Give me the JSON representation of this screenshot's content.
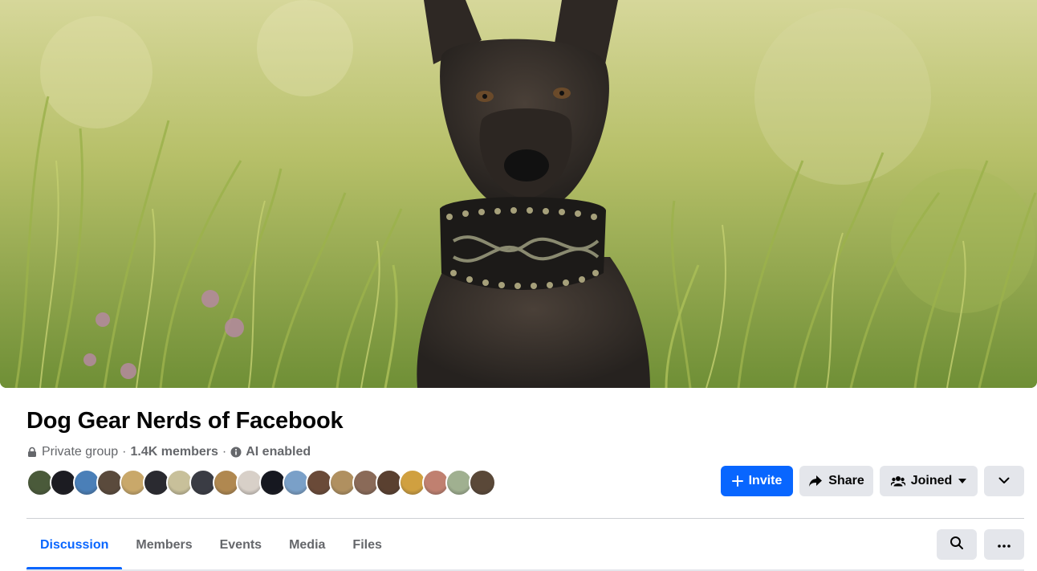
{
  "group": {
    "name": "Dog Gear Nerds of Facebook",
    "privacy": "Private group",
    "separator": "·",
    "members": "1.4K members",
    "ai": "AI enabled"
  },
  "actions": {
    "invite": "Invite",
    "share": "Share",
    "joined": "Joined"
  },
  "tabs": [
    {
      "label": "Discussion",
      "active": true
    },
    {
      "label": "Members",
      "active": false
    },
    {
      "label": "Events",
      "active": false
    },
    {
      "label": "Media",
      "active": false
    },
    {
      "label": "Files",
      "active": false
    }
  ],
  "member_avatar_colors": [
    "#4a5a3a",
    "#1c1c22",
    "#4a7fb8",
    "#5a4a3c",
    "#c9a86a",
    "#2a2a30",
    "#c8c09a",
    "#3a3c44",
    "#b08850",
    "#d8d0c8",
    "#161820",
    "#7aa0c8",
    "#6a4a38",
    "#b09060",
    "#8a6a58",
    "#5a4030",
    "#d0a040",
    "#c08070",
    "#a0b090",
    "#5a4838"
  ],
  "colors": {
    "primary": "#0866ff",
    "secondary_button": "#e4e6eb",
    "muted_text": "#65676b"
  },
  "icons": {
    "privacy": "lock-icon",
    "ai": "info-icon",
    "invite": "plus-icon",
    "share": "share-arrow-icon",
    "joined": "group-people-icon",
    "search": "search-icon",
    "more": "more-horizontal-icon"
  }
}
